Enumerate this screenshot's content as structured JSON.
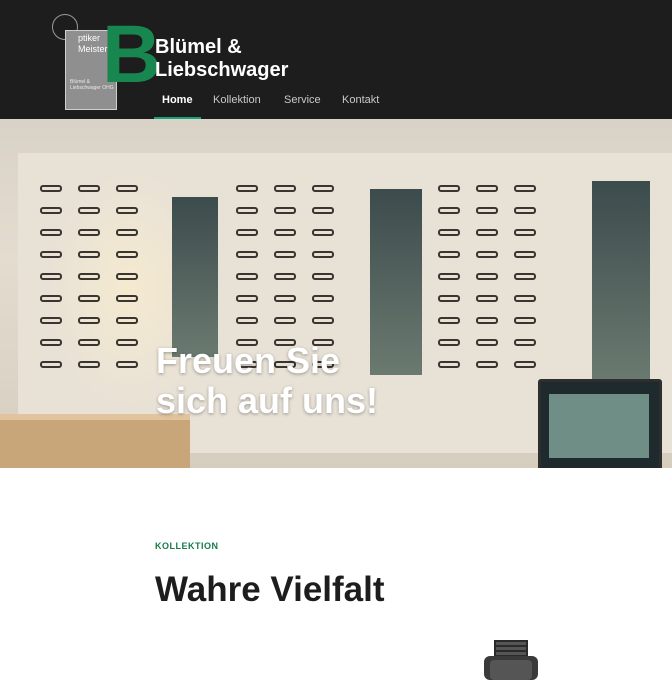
{
  "logo": {
    "line1": "ptiker",
    "line2": "Meister",
    "small_text": "Blümel & Liebschwager OHG",
    "letter": "B"
  },
  "brand": {
    "line1": "Blümel &",
    "line2": "Liebschwager"
  },
  "nav": {
    "items": [
      {
        "label": "Home",
        "active": true
      },
      {
        "label": "Kollektion",
        "active": false
      },
      {
        "label": "Service",
        "active": false
      },
      {
        "label": "Kontakt",
        "active": false
      }
    ]
  },
  "hero": {
    "title_line1": "Freuen Sie",
    "title_line2": "sich auf uns!"
  },
  "section": {
    "eyebrow": "KOLLEKTION",
    "heading": "Wahre Vielfalt"
  },
  "colors": {
    "header_bg": "#1d1d1d",
    "accent_green": "#18864f",
    "nav_active_underline": "#1aa37a"
  }
}
